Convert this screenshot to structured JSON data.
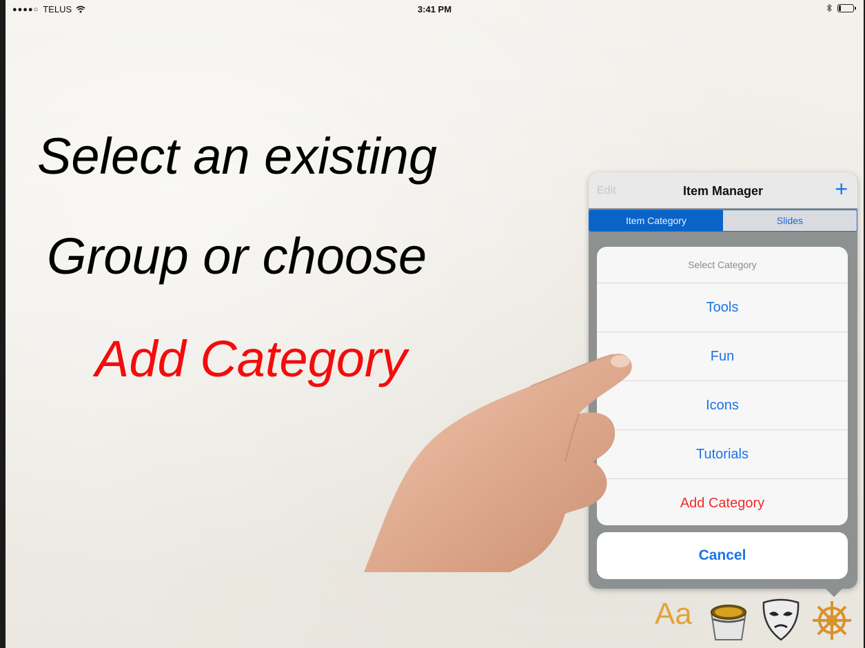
{
  "status_bar": {
    "signal": "●●●●○",
    "carrier": "TELUS",
    "time": "3:41 PM"
  },
  "headline": {
    "line1": "Select an existing",
    "line2": "Group or choose",
    "line3": "Add Category"
  },
  "item_manager": {
    "edit_label": "Edit",
    "title": "Item Manager",
    "add_icon": "plus-icon",
    "segments": [
      "Item Category",
      "Slides"
    ],
    "selected_segment": "Item Category"
  },
  "action_sheet": {
    "title": "Select Category",
    "items": [
      "Tools",
      "Fun",
      "Icons",
      "Tutorials"
    ],
    "add_label": "Add Category",
    "cancel_label": "Cancel"
  },
  "toolbar": {
    "font_label": "Aa",
    "icons": [
      "font-icon",
      "paint-bucket-icon",
      "theater-mask-icon",
      "ship-wheel-icon"
    ]
  },
  "colors": {
    "headline_accent": "#f40c0c",
    "ios_blue": "#1a73e8",
    "destructive_red": "#ef2b2b",
    "toolbar_gold": "#e3a33a"
  }
}
